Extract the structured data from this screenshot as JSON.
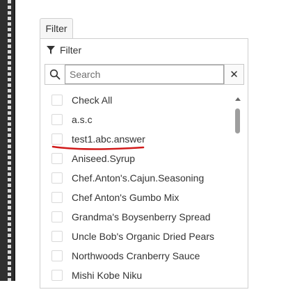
{
  "filter_button": {
    "label": "Filter"
  },
  "popup": {
    "header_label": "Filter",
    "search": {
      "placeholder": "Search",
      "value": ""
    },
    "clear_label": "✕",
    "items": [
      {
        "label": "Check All",
        "checked": false
      },
      {
        "label": "a.s.c",
        "checked": false
      },
      {
        "label": "test1.abc.answer",
        "checked": false
      },
      {
        "label": "Aniseed.Syrup",
        "checked": false
      },
      {
        "label": "Chef.Anton's.Cajun.Seasoning",
        "checked": false
      },
      {
        "label": "Chef Anton's Gumbo Mix",
        "checked": false
      },
      {
        "label": "Grandma's Boysenberry Spread",
        "checked": false
      },
      {
        "label": "Uncle Bob's Organic Dried Pears",
        "checked": false
      },
      {
        "label": "Northwoods Cranberry Sauce",
        "checked": false
      },
      {
        "label": "Mishi Kobe Niku",
        "checked": false
      }
    ]
  },
  "icons": {
    "header": "funnel-icon",
    "search": "magnifier-icon",
    "clear": "close-icon"
  },
  "colors": {
    "annotation": "#d11a1a",
    "border": "#cfcfcf",
    "text": "#333333"
  }
}
